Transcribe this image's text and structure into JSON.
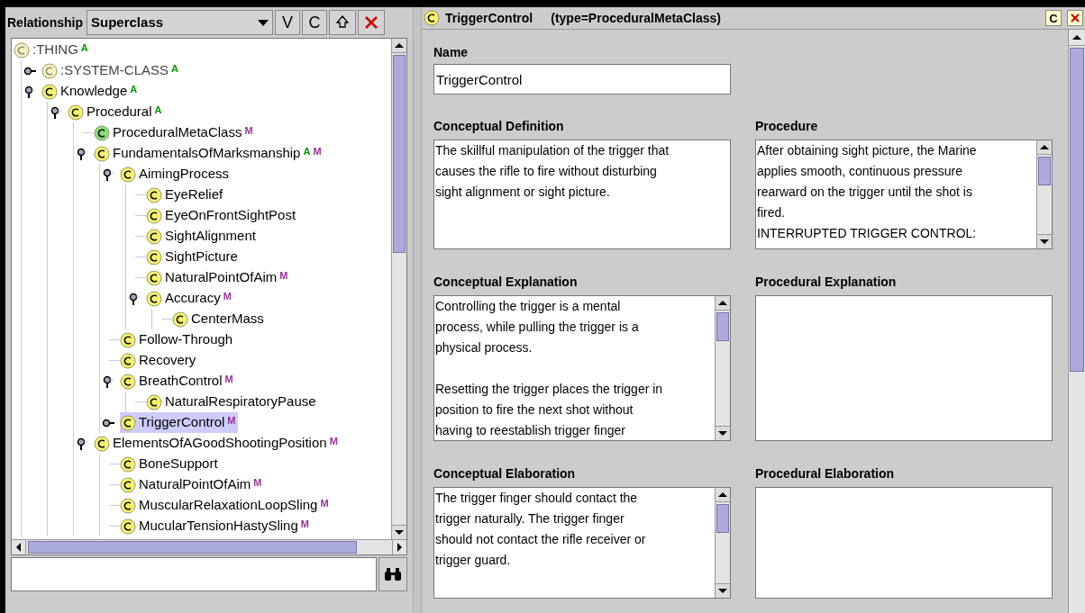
{
  "left_panel": {
    "relationship_label": "Relationship",
    "relationship_value": "Superclass",
    "buttons": [
      "V",
      "C"
    ],
    "tree": [
      {
        "label": ":THING",
        "kind": "pale",
        "badges": [
          {
            "text": "A",
            "color": "#009900"
          }
        ],
        "selected": false,
        "children": [
          {
            "label": ":SYSTEM-CLASS",
            "kind": "pale",
            "badges": [
              {
                "text": "A",
                "color": "#009900"
              }
            ],
            "selected": false,
            "expanded": false
          },
          {
            "label": "Knowledge",
            "kind": "class",
            "badges": [
              {
                "text": "A",
                "color": "#009900"
              }
            ],
            "selected": false,
            "expanded": true,
            "children": [
              {
                "label": "Procedural",
                "kind": "class",
                "badges": [
                  {
                    "text": "A",
                    "color": "#009900"
                  }
                ],
                "selected": false,
                "expanded": true,
                "children": [
                  {
                    "label": "ProceduralMetaClass",
                    "kind": "metaclass",
                    "badges": [
                      {
                        "text": "M",
                        "color": "#993399"
                      }
                    ],
                    "selected": false
                  },
                  {
                    "label": "FundamentalsOfMarksmanship",
                    "kind": "class",
                    "badges": [
                      {
                        "text": "A",
                        "color": "#009900"
                      },
                      {
                        "text": "M",
                        "color": "#993399"
                      }
                    ],
                    "selected": false,
                    "expanded": true,
                    "children": [
                      {
                        "label": "AimingProcess",
                        "kind": "class",
                        "selected": false,
                        "expanded": true,
                        "children": [
                          {
                            "label": "EyeRelief",
                            "kind": "class",
                            "selected": false
                          },
                          {
                            "label": "EyeOnFrontSightPost",
                            "kind": "class",
                            "selected": false
                          },
                          {
                            "label": "SightAlignment",
                            "kind": "class",
                            "selected": false
                          },
                          {
                            "label": "SightPicture",
                            "kind": "class",
                            "selected": false
                          },
                          {
                            "label": "NaturalPointOfAim",
                            "kind": "class",
                            "badges": [
                              {
                                "text": "M",
                                "color": "#993399"
                              }
                            ],
                            "selected": false
                          },
                          {
                            "label": "Accuracy",
                            "kind": "class",
                            "badges": [
                              {
                                "text": "M",
                                "color": "#993399"
                              }
                            ],
                            "selected": false,
                            "expanded": true,
                            "children": [
                              {
                                "label": "CenterMass",
                                "kind": "class",
                                "selected": false
                              }
                            ]
                          }
                        ]
                      },
                      {
                        "label": "Follow-Through",
                        "kind": "class",
                        "selected": false
                      },
                      {
                        "label": "Recovery",
                        "kind": "class",
                        "selected": false
                      },
                      {
                        "label": "BreathControl",
                        "kind": "class",
                        "badges": [
                          {
                            "text": "M",
                            "color": "#993399"
                          }
                        ],
                        "selected": false,
                        "expanded": true,
                        "children": [
                          {
                            "label": "NaturalRespiratoryPause",
                            "kind": "class",
                            "selected": false
                          }
                        ]
                      },
                      {
                        "label": "TriggerControl",
                        "kind": "class",
                        "badges": [
                          {
                            "text": "M",
                            "color": "#993399"
                          }
                        ],
                        "selected": true,
                        "expanded": false
                      }
                    ]
                  },
                  {
                    "label": "ElementsOfAGoodShootingPosition",
                    "kind": "class",
                    "badges": [
                      {
                        "text": "M",
                        "color": "#993399"
                      }
                    ],
                    "selected": false,
                    "expanded": true,
                    "children": [
                      {
                        "label": "BoneSupport",
                        "kind": "class",
                        "selected": false
                      },
                      {
                        "label": "NaturalPointOfAim",
                        "kind": "class",
                        "badges": [
                          {
                            "text": "M",
                            "color": "#993399"
                          }
                        ],
                        "selected": false
                      },
                      {
                        "label": "MuscularRelaxationLoopSling",
                        "kind": "class",
                        "badges": [
                          {
                            "text": "M",
                            "color": "#993399"
                          }
                        ],
                        "selected": false
                      },
                      {
                        "label": "MucularTensionHastySling",
                        "kind": "class",
                        "badges": [
                          {
                            "text": "M",
                            "color": "#993399"
                          }
                        ],
                        "selected": false
                      }
                    ]
                  }
                ]
              }
            ]
          }
        ]
      }
    ]
  },
  "right_panel": {
    "title": "TriggerControl",
    "type_label": "(type=ProceduralMetaClass)",
    "header_button": "C",
    "name": {
      "label": "Name",
      "value": "TriggerControl"
    },
    "fields": [
      {
        "label": "Conceptual Definition",
        "kind": "plain",
        "value": "The skillful manipulation of the trigger that\ncauses the rifle to fire without disturbing\nsight alignment or sight picture."
      },
      {
        "label": "Procedure",
        "kind": "scrolling",
        "value": "After obtaining sight picture, the Marine\napplies smooth, continuous pressure\nrearward on the trigger until the shot is\nfired.\nINTERRUPTED TRIGGER CONTROL:"
      },
      {
        "label": "Conceptual Explanation",
        "kind": "scrolling",
        "value": "Controlling the trigger is a mental\nprocess, while pulling the trigger is a\nphysical process.\n\nResetting the trigger places the trigger in\nposition to fire the next shot without\nhaving to reestablish trigger finger"
      },
      {
        "label": "Procedural Explanation",
        "kind": "plain"
      },
      {
        "label": "Conceptual Elaboration",
        "kind": "scrolling",
        "value": "The trigger finger should contact the\ntrigger naturally. The trigger finger\nshould not contact the rifle receiver or\ntrigger guard."
      },
      {
        "label": "Procedural Elaboration",
        "kind": "plain"
      }
    ]
  }
}
